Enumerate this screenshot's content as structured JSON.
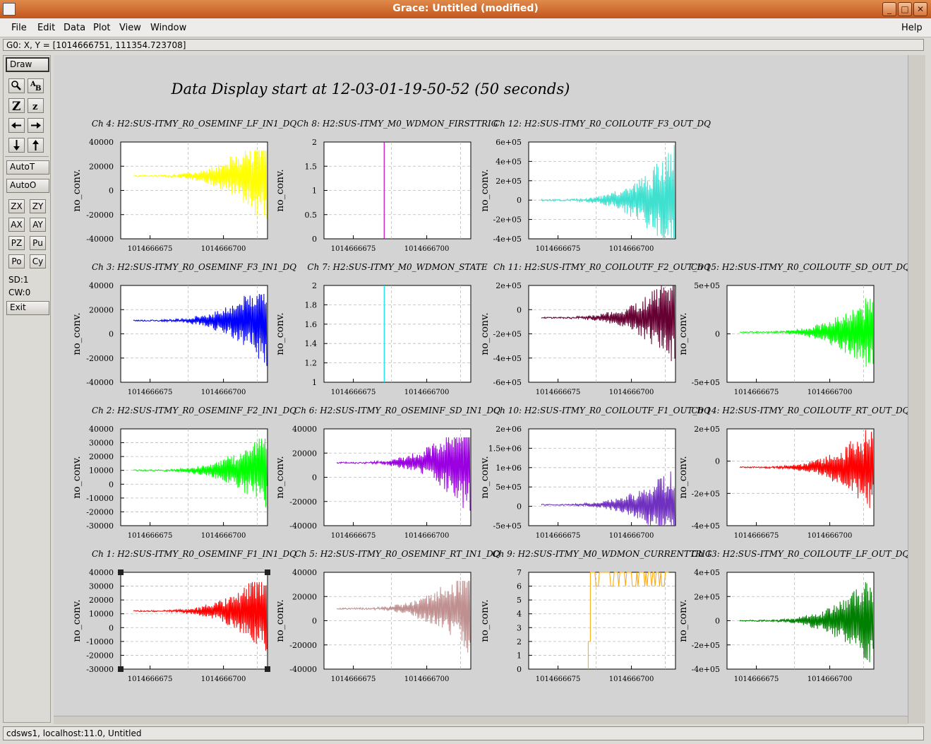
{
  "window": {
    "title": "Grace: Untitled (modified)",
    "buttons": [
      "_",
      "□",
      "✕"
    ]
  },
  "menubar": {
    "items": [
      "File",
      "Edit",
      "Data",
      "Plot",
      "View",
      "Window"
    ],
    "help": "Help"
  },
  "locator": "G0: X, Y = [1014666751, 111354.723708]",
  "toolbar": {
    "draw": "Draw",
    "autot": "AutoT",
    "autoo": "AutoO",
    "small_buttons": [
      "ZX",
      "ZY",
      "AX",
      "AY",
      "PZ",
      "Pu",
      "Po",
      "Cy"
    ],
    "sd": "SD:1",
    "cw": "CW:0",
    "exit": "Exit",
    "icons": [
      "magnifier-icon",
      "text-icon",
      "zoom-in-icon",
      "zoom-out-icon",
      "arrow-left-icon",
      "arrow-right-icon",
      "arrow-down-icon",
      "arrow-up-icon"
    ]
  },
  "status": "cdsws1, localhost:11.0, Untitled",
  "canvas_title": "Data Display start at 12-03-01-19-50-52 (50 seconds)",
  "ylabel": "no_conv.",
  "xticks": [
    "1014666675",
    "1014666700"
  ],
  "chart_data": [
    {
      "type": "line",
      "title": "Ch 4: H2:SUS-ITMY_R0_OSEMINF_LF_IN1_DQ",
      "ylabel": "no_conv.",
      "yticks": [
        "40000",
        "20000",
        "0",
        "-20000",
        "-40000"
      ],
      "ylim": [
        -40000,
        40000
      ],
      "color": "#ffff00",
      "signal": {
        "kind": "growing-noise",
        "offset": 12000,
        "max_amp": 45000,
        "clip": [
          -40000,
          33000
        ]
      }
    },
    {
      "type": "line",
      "title": "Ch 8: H2:SUS-ITMY_M0_WDMON_FIRSTTRIG",
      "ylabel": "no_conv.",
      "yticks": [
        "2",
        "1.5",
        "1",
        "0.5",
        "0"
      ],
      "ylim": [
        0,
        2
      ],
      "color": "#cc00cc",
      "signal": {
        "kind": "vertical",
        "x_at_fraction": 0.41
      }
    },
    {
      "type": "line",
      "title": "Ch 12: H2:SUS-ITMY_R0_COILOUTF_F3_OUT_DQ",
      "ylabel": "no_conv.",
      "yticks": [
        "6e+05",
        "4e+05",
        "2e+05",
        "0",
        "-2e+05",
        "-4e+05"
      ],
      "ylim": [
        -400000,
        600000
      ],
      "color": "#40e0d0",
      "signal": {
        "kind": "growing-noise",
        "offset": 0,
        "max_amp": 600000,
        "clip": [
          -400000,
          600000
        ]
      }
    },
    {
      "type": "line",
      "title": "Ch 3: H2:SUS-ITMY_R0_OSEMINF_F3_IN1_DQ",
      "ylabel": "no_conv.",
      "yticks": [
        "40000",
        "20000",
        "0",
        "-20000",
        "-40000"
      ],
      "ylim": [
        -40000,
        40000
      ],
      "color": "#0000ff",
      "signal": {
        "kind": "growing-noise",
        "offset": 11000,
        "max_amp": 38000,
        "clip": [
          -40000,
          33000
        ]
      }
    },
    {
      "type": "line",
      "title": "Ch 7: H2:SUS-ITMY_M0_WDMON_STATE",
      "ylabel": "no_conv.",
      "yticks": [
        "2",
        "1.8",
        "1.6",
        "1.4",
        "1.2",
        "1"
      ],
      "ylim": [
        1,
        2
      ],
      "color": "#00e5ee",
      "signal": {
        "kind": "vertical",
        "x_at_fraction": 0.41
      }
    },
    {
      "type": "line",
      "title": "Ch 11: H2:SUS-ITMY_R0_COILOUTF_F2_OUT_DQ",
      "ylabel": "no_conv.",
      "yticks": [
        "2e+05",
        "0",
        "-2e+05",
        "-4e+05",
        "-6e+05"
      ],
      "ylim": [
        -600000,
        300000
      ],
      "color": "#660033",
      "signal": {
        "kind": "growing-noise",
        "offset": 0,
        "max_amp": 450000,
        "clip": [
          -600000,
          300000
        ]
      }
    },
    {
      "type": "line",
      "title": "Ch 15: H2:SUS-ITMY_R0_COILOUTF_SD_OUT_DQ",
      "ylabel": "no_conv.",
      "yticks": [
        "5e+05",
        "0",
        "-5e+05"
      ],
      "ylim": [
        -750000,
        700000
      ],
      "color": "#00ff00",
      "signal": {
        "kind": "growing-noise",
        "offset": 0,
        "max_amp": 650000,
        "clip": [
          -750000,
          700000
        ]
      }
    },
    {
      "type": "line",
      "title": "Ch 2: H2:SUS-ITMY_R0_OSEMINF_F2_IN1_DQ",
      "ylabel": "no_conv.",
      "yticks": [
        "40000",
        "30000",
        "20000",
        "10000",
        "0",
        "-10000",
        "-20000",
        "-30000"
      ],
      "ylim": [
        -30000,
        40000
      ],
      "color": "#00ff00",
      "signal": {
        "kind": "growing-noise",
        "offset": 10000,
        "max_amp": 30000,
        "clip": [
          -30000,
          33000
        ]
      }
    },
    {
      "type": "line",
      "title": "Ch 6: H2:SUS-ITMY_R0_OSEMINF_SD_IN1_DQ",
      "ylabel": "no_conv.",
      "yticks": [
        "40000",
        "20000",
        "0",
        "-20000",
        "-40000"
      ],
      "ylim": [
        -40000,
        40000
      ],
      "color": "#9a00e0",
      "signal": {
        "kind": "growing-noise",
        "offset": 12000,
        "max_amp": 45000,
        "clip": [
          -40000,
          33000
        ]
      }
    },
    {
      "type": "line",
      "title": "Ch 10: H2:SUS-ITMY_R0_COILOUTF_F1_OUT_DQ",
      "ylabel": "no_conv.",
      "yticks": [
        "2e+06",
        "1.5e+06",
        "1e+06",
        "5e+05",
        "0",
        "-5e+05"
      ],
      "ylim": [
        -550000,
        2000000
      ],
      "color": "#7030c0",
      "signal": {
        "kind": "growing-noise",
        "offset": 0,
        "max_amp": 1100000,
        "clip": [
          -550000,
          2000000
        ]
      }
    },
    {
      "type": "line",
      "title": "Ch 14: H2:SUS-ITMY_R0_COILOUTF_RT_OUT_DQ",
      "ylabel": "no_conv.",
      "yticks": [
        "2e+05",
        "0",
        "-2e+05",
        "-4e+05"
      ],
      "ylim": [
        -500000,
        330000
      ],
      "color": "#ff0000",
      "signal": {
        "kind": "growing-noise",
        "offset": 0,
        "max_amp": 400000,
        "clip": [
          -500000,
          330000
        ]
      }
    },
    {
      "type": "line",
      "title": "Ch 1: H2:SUS-ITMY_R0_OSEMINF_F1_IN1_DQ",
      "ylabel": "no_conv.",
      "yticks": [
        "40000",
        "30000",
        "20000",
        "10000",
        "0",
        "-10000",
        "-20000",
        "-30000"
      ],
      "ylim": [
        -30000,
        40000
      ],
      "color": "#ff0000",
      "signal": {
        "kind": "growing-noise",
        "offset": 12000,
        "max_amp": 32000,
        "clip": [
          -30000,
          33000
        ]
      },
      "selected": true
    },
    {
      "type": "line",
      "title": "Ch 5: H2:SUS-ITMY_R0_OSEMINF_RT_IN1_DQ",
      "ylabel": "no_conv.",
      "yticks": [
        "40000",
        "20000",
        "0",
        "-20000",
        "-40000"
      ],
      "ylim": [
        -40000,
        40000
      ],
      "color": "#c09090",
      "signal": {
        "kind": "growing-noise",
        "offset": 10000,
        "max_amp": 40000,
        "clip": [
          -40000,
          33000
        ]
      }
    },
    {
      "type": "line",
      "title": "Ch 9: H2:SUS-ITMY_M0_WDMON_CURRENTTRIG",
      "ylabel": "no_conv.",
      "yticks": [
        "7",
        "6",
        "5",
        "4",
        "3",
        "2",
        "1",
        "0"
      ],
      "ylim": [
        0,
        7
      ],
      "color": "#ffa500",
      "signal": {
        "kind": "step",
        "rise_fraction": 0.42
      }
    },
    {
      "type": "line",
      "title": "Ch 13: H2:SUS-ITMY_R0_COILOUTF_LF_OUT_DQ",
      "ylabel": "no_conv.",
      "yticks": [
        "4e+05",
        "2e+05",
        "0",
        "-2e+05",
        "-4e+05"
      ],
      "ylim": [
        -400000,
        400000
      ],
      "color": "#008000",
      "signal": {
        "kind": "growing-noise",
        "offset": 0,
        "max_amp": 400000,
        "clip": [
          -400000,
          400000
        ]
      }
    }
  ]
}
